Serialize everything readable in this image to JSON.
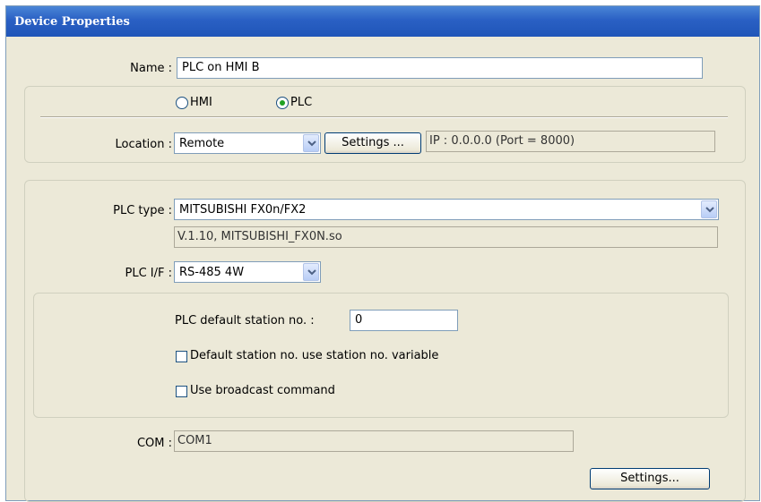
{
  "window": {
    "title": "Device Properties"
  },
  "name": {
    "label": "Name :",
    "value": "PLC on HMI B"
  },
  "device_kind": {
    "options": [
      {
        "label": "HMI",
        "selected": false
      },
      {
        "label": "PLC",
        "selected": true
      }
    ]
  },
  "location": {
    "label": "Location :",
    "value": "Remote",
    "settings_label": "Settings ...",
    "ip_info": "IP : 0.0.0.0 (Port = 8000)"
  },
  "plc": {
    "type_label": "PLC type :",
    "type_value": "MITSUBISHI FX0n/FX2",
    "driver_info": "V.1.10, MITSUBISHI_FX0N.so",
    "if_label": "PLC I/F :",
    "if_value": "RS-485 4W"
  },
  "station": {
    "default_label": "PLC default station no. :",
    "default_value": "0",
    "use_variable_label": "Default station no. use station no. variable",
    "use_variable_checked": false,
    "broadcast_label": "Use broadcast command",
    "broadcast_checked": false
  },
  "com": {
    "label": "COM :",
    "value": "COM1",
    "settings_label": "Settings..."
  },
  "colors": {
    "title_bar": "#2a60c4",
    "dialog_bg": "#ece9d8",
    "radio_dot": "#21a121"
  }
}
